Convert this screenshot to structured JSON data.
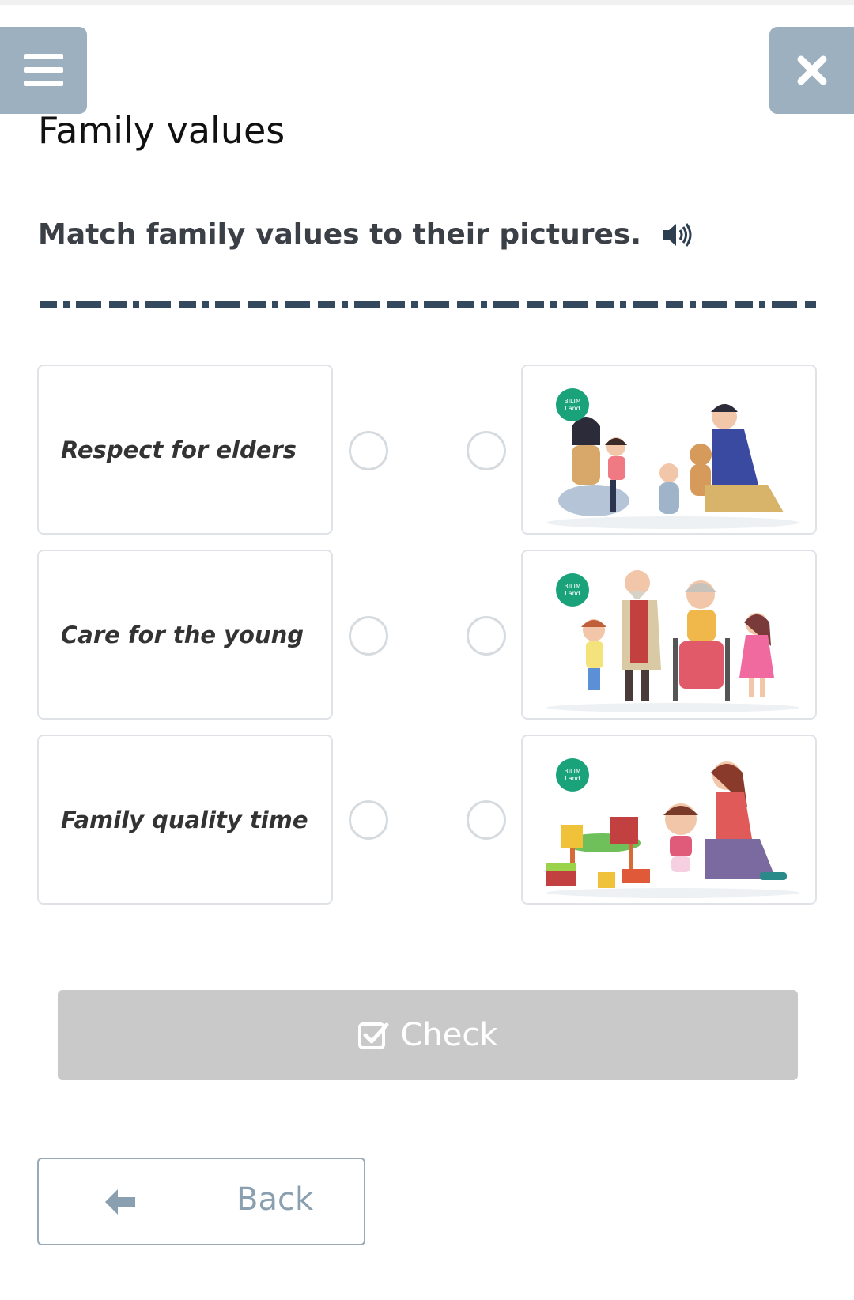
{
  "header": {
    "menu_icon": "hamburger-menu-icon",
    "close_icon": "close-x-icon",
    "title": "Family values"
  },
  "exercise": {
    "instruction": "Match family values to their pictures.",
    "audio_icon": "speaker-icon",
    "left_items": [
      {
        "label": "Respect for elders"
      },
      {
        "label": "Care for the young"
      },
      {
        "label": "Family quality time"
      }
    ],
    "right_items": [
      {
        "image": "family-playing-with-children",
        "badge": "BILIM Land"
      },
      {
        "image": "children-with-grandparents",
        "badge": "BILIM Land"
      },
      {
        "image": "mother-braiding-daughters-hair-with-toys",
        "badge": "BILIM Land"
      }
    ]
  },
  "footer": {
    "check_label": "Check",
    "check_icon": "checkbox-icon",
    "back_label": "Back",
    "back_icon": "arrow-left-icon"
  },
  "colors": {
    "nav_button": "#9db0bf",
    "check_button": "#c9c9c9",
    "badge_green": "#1aa37a",
    "dash_rule": "#34495e"
  }
}
